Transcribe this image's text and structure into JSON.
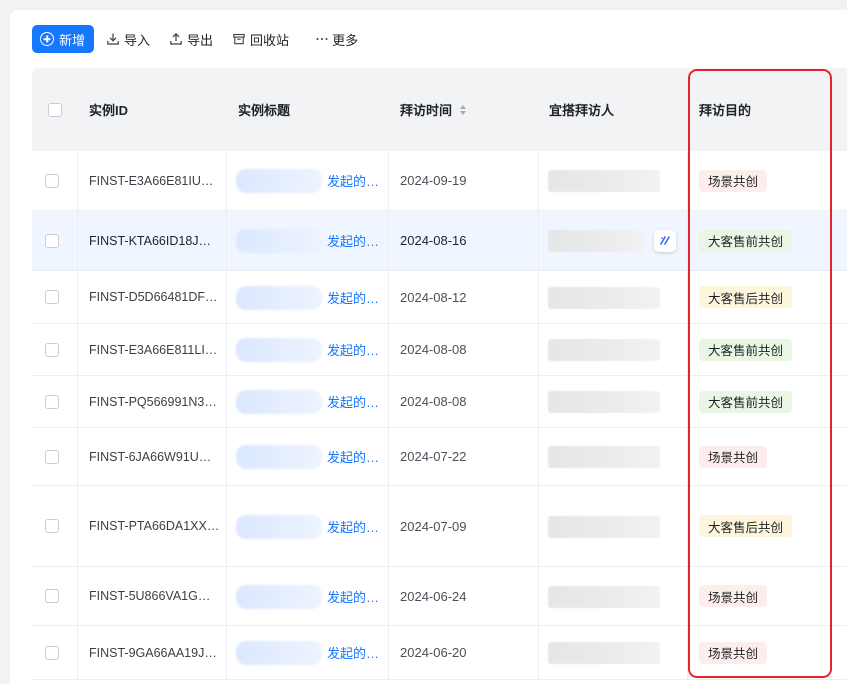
{
  "toolbar": {
    "new_label": "新增",
    "import_label": "导入",
    "export_label": "导出",
    "recycle_label": "回收站",
    "more_label": "更多"
  },
  "columns": {
    "id": "实例ID",
    "title": "实例标题",
    "visit_time": "拜访时间",
    "visitor": "宜搭拜访人",
    "purpose": "拜访目的"
  },
  "rows": [
    {
      "id": "FINST-E3A66E81IU…",
      "title_link": "发起的…",
      "date": "2024-09-19",
      "purpose": "场景共创",
      "tag_color": "#fdeded"
    },
    {
      "id": "FINST-KTA66ID18J…",
      "title_link": "发起的…",
      "date": "2024-08-16",
      "purpose": "大客售前共创",
      "tag_color": "#e9f6e4"
    },
    {
      "id": "FINST-D5D66481DF…",
      "title_link": "发起的…",
      "date": "2024-08-12",
      "purpose": "大客售后共创",
      "tag_color": "#fdf5dc"
    },
    {
      "id": "FINST-E3A66E811LI…",
      "title_link": "发起的…",
      "date": "2024-08-08",
      "purpose": "大客售前共创",
      "tag_color": "#e9f6e4"
    },
    {
      "id": "FINST-PQ566991N3…",
      "title_link": "发起的…",
      "date": "2024-08-08",
      "purpose": "大客售前共创",
      "tag_color": "#e9f6e4"
    },
    {
      "id": "FINST-6JA66W91U…",
      "title_link": "发起的…",
      "date": "2024-07-22",
      "purpose": "场景共创",
      "tag_color": "#fdeded"
    },
    {
      "id": "FINST-PTA66DA1XX…",
      "title_link": "发起的…",
      "date": "2024-07-09",
      "purpose": "大客售后共创",
      "tag_color": "#fdf5dc"
    },
    {
      "id": "FINST-5U866VA1G…",
      "title_link": "发起的…",
      "date": "2024-06-24",
      "purpose": "场景共创",
      "tag_color": "#fdeded"
    },
    {
      "id": "FINST-9GA66AA19J…",
      "title_link": "发起的…",
      "date": "2024-06-20",
      "purpose": "场景共创",
      "tag_color": "#fdeded"
    }
  ],
  "colors": {
    "primary": "#1677ff",
    "highlight_row": "#f0f6ff",
    "annotation_box": "#e5232d"
  }
}
